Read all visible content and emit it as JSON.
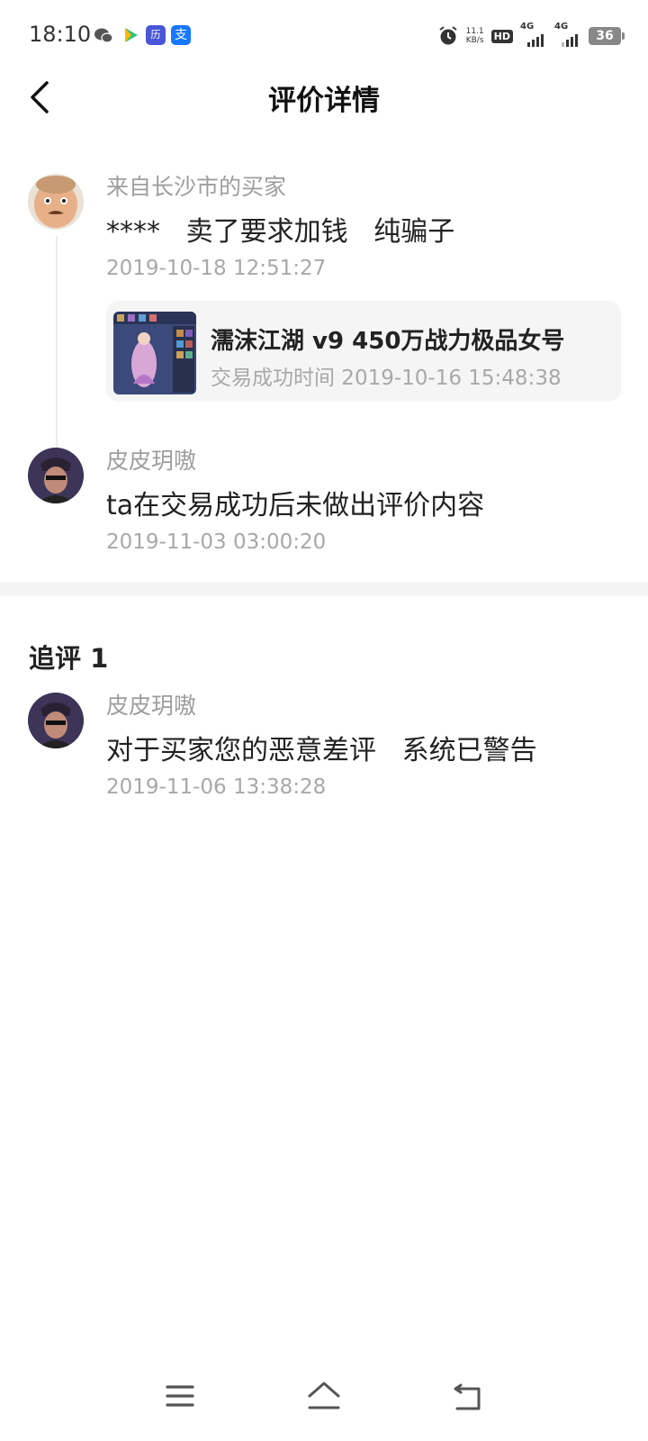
{
  "status_bar": {
    "time": "18:10",
    "hist_label": "历",
    "alipay_label": "支",
    "speed_value": "11.1",
    "speed_unit": "KB/s",
    "hd_label": "HD",
    "sim1_label": "4G",
    "sim2_label": "4G",
    "battery": "36",
    "icons": [
      "wechat-icon",
      "video-app-icon",
      "history-app-icon",
      "alipay-icon",
      "alarm-icon",
      "hd-icon",
      "signal-icon",
      "battery-icon"
    ]
  },
  "header": {
    "title": "评价详情",
    "back_icon": "chevron-left-icon"
  },
  "reviews": [
    {
      "author": "来自长沙市的买家",
      "content": "****   卖了要求加钱   纯骗子",
      "time": "2019-10-18 12:51:27"
    },
    {
      "author": "皮皮玥嗷",
      "content": "ta在交易成功后未做出评价内容",
      "time": "2019-11-03 03:00:20"
    }
  ],
  "product": {
    "title": "濡沫江湖  v9 450万战力极品女号",
    "meta": "交易成功时间 2019-10-16 15:48:38"
  },
  "followup": {
    "title": "追评 1",
    "author": "皮皮玥嗷",
    "content": "对于买家您的恶意差评   系统已警告",
    "time": "2019-11-06 13:38:28"
  },
  "bottom_nav": {
    "icons": [
      "menu-icon",
      "home-icon",
      "back-icon"
    ]
  }
}
